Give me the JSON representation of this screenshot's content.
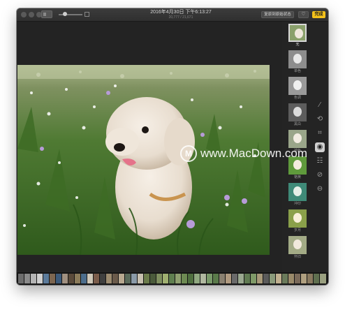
{
  "titlebar": {
    "date_title": "2016年4月30日 下午6:13:27",
    "photo_count": "20,777 / 21,671",
    "revert_label": "复原到原始状态",
    "favorite_icon": "heart-icon",
    "done_label": "完成"
  },
  "filters": [
    {
      "label": "无",
      "selected": true
    },
    {
      "label": "单色",
      "selected": false
    },
    {
      "label": "色调",
      "selected": false
    },
    {
      "label": "黑白",
      "selected": false
    },
    {
      "label": "褪色",
      "selected": false
    },
    {
      "label": "铬黄",
      "selected": false
    },
    {
      "label": "冲印",
      "selected": false
    },
    {
      "label": "岁月",
      "selected": false
    },
    {
      "label": "怀旧",
      "selected": false
    }
  ],
  "tools": [
    {
      "icon": "magic-wand-icon",
      "active": false
    },
    {
      "icon": "crop-icon",
      "active": false
    },
    {
      "icon": "adjust-icon",
      "active": false
    },
    {
      "icon": "filters-icon",
      "active": true
    },
    {
      "icon": "retouch-icon",
      "active": false
    },
    {
      "icon": "bandage-icon",
      "active": false
    },
    {
      "icon": "more-icon",
      "active": false
    }
  ],
  "watermark": {
    "text": "www.MacDown.com",
    "logo_glyph": "M"
  }
}
